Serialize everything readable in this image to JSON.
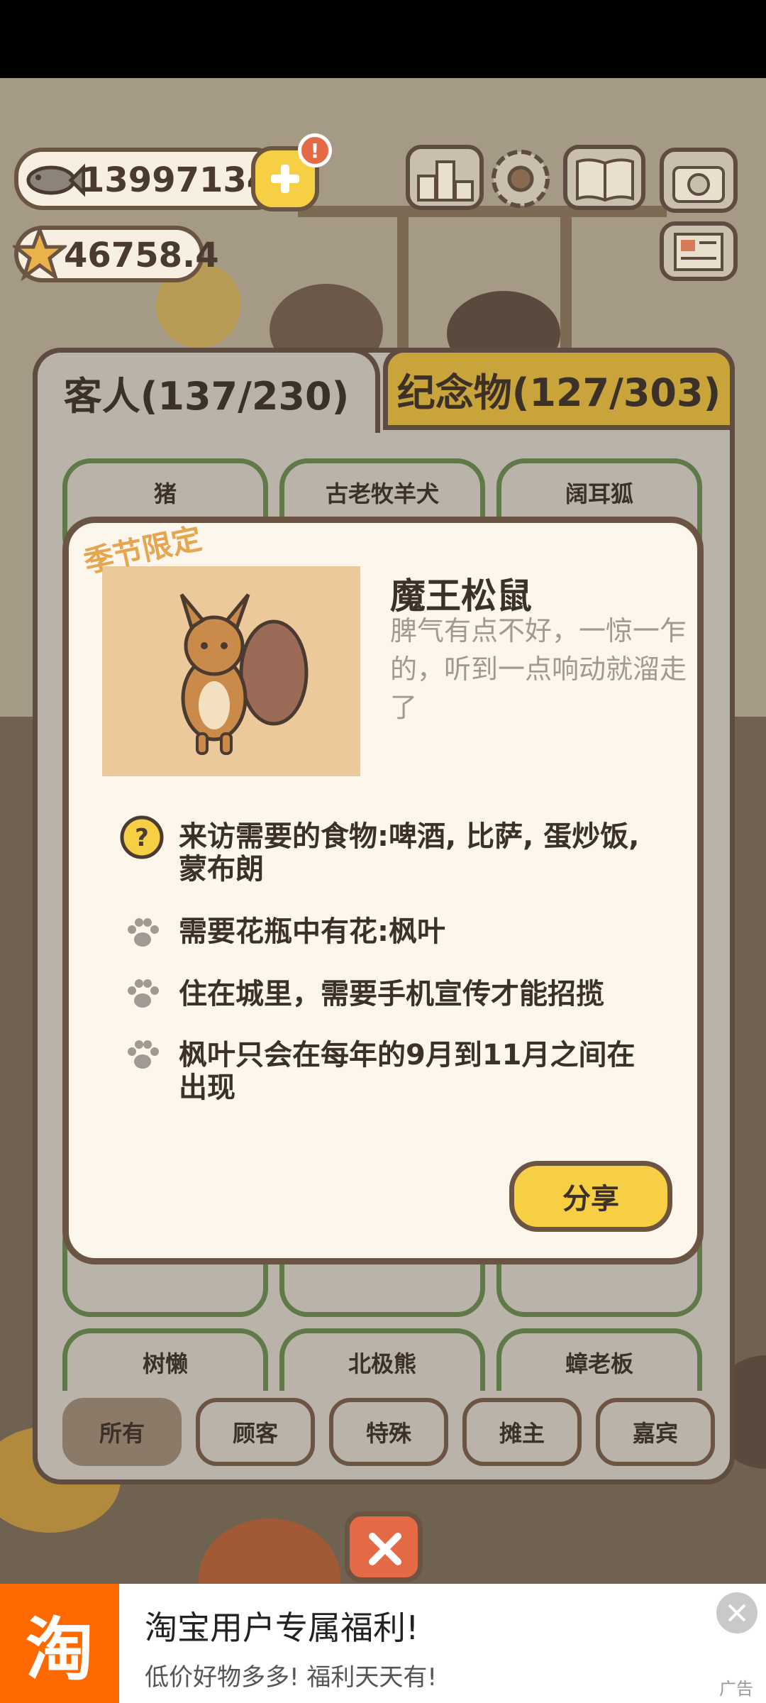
{
  "currency": {
    "fish": "13997134",
    "stars": "46758.4"
  },
  "tabs": {
    "guests": "客人(137/230)",
    "souvenirs": "纪念物(127/303)"
  },
  "grid": {
    "row1": [
      "猪",
      "古老牧羊犬",
      "阔耳狐"
    ],
    "row3": [
      "树懒",
      "北极熊",
      "蟑老板"
    ]
  },
  "filters": [
    "所有",
    "顾客",
    "特殊",
    "摊主",
    "嘉宾"
  ],
  "detail": {
    "badge": "季节限定",
    "name": "魔王松鼠",
    "description": "脾气有点不好，一惊一乍的，听到一点响动就溜走了",
    "requirements": [
      "来访需要的食物:啤酒, 比萨, 蛋炒饭, 蒙布朗",
      "需要花瓶中有花:枫叶",
      "住在城里，需要手机宣传才能招揽",
      "枫叶只会在每年的9月到11月之间在出现"
    ],
    "share": "分享"
  },
  "ad": {
    "logo": "淘",
    "title": "淘宝用户专属福利!",
    "subtitle": "低价好物多多! 福利天天有!",
    "label": "广告"
  },
  "colors": {
    "accent_yellow": "#f7cf45",
    "border_brown": "#6c5443",
    "ad_orange": "#ff6a00"
  }
}
